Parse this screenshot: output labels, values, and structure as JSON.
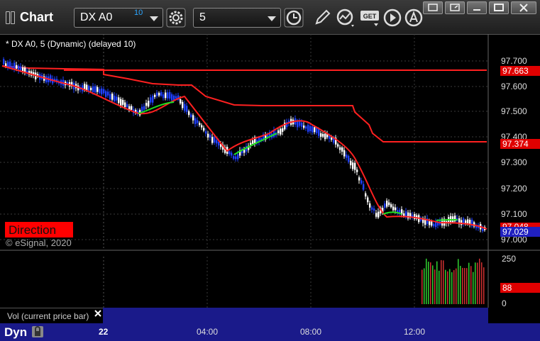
{
  "app": {
    "title": "Chart",
    "symbol": "DX A0",
    "delay_badge": "10",
    "interval": "5"
  },
  "main_chart": {
    "legend": "* DX A0, 5 (Dynamic) (delayed 10)",
    "direction_label": "Direction",
    "copyright": "© eSignal, 2020",
    "price_axis": [
      "97.700",
      "97.600",
      "97.500",
      "97.400",
      "97.300",
      "97.200",
      "97.100",
      "97.000"
    ],
    "price_tags": [
      {
        "label": "97.663",
        "color": "#e00000"
      },
      {
        "label": "97.374",
        "color": "#e00000"
      },
      {
        "label": "97.048",
        "color": "#e00000"
      },
      {
        "label": "97.029",
        "color": "#2020c0"
      }
    ]
  },
  "volume_chart": {
    "legend": "Vol (current price bar)",
    "axis": [
      "250",
      "0"
    ],
    "current_tag": {
      "label": "88",
      "color": "#e00000"
    }
  },
  "time_axis": {
    "interval_label": "Dyn",
    "ticks": [
      "22",
      "04:00",
      "08:00",
      "12:00"
    ]
  },
  "colors": {
    "stop_line": "#ff2020",
    "up_ma": "#20e020",
    "down_ma": "#ff2020",
    "up_bar": "#ffffff",
    "down_bar": "#2040ff",
    "bottom_bar": "#1a1a8a"
  },
  "icons": [
    "settings-gear-icon",
    "clock-icon",
    "pencil-icon",
    "indicator-icon",
    "get-icon",
    "play-icon",
    "alert-icon",
    "close-icon"
  ]
}
